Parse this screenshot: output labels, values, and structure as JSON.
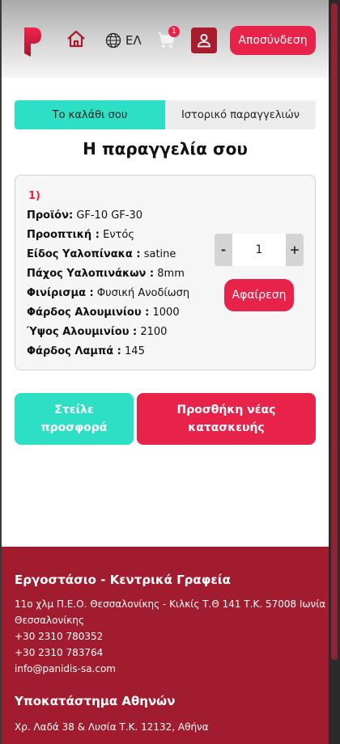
{
  "header": {
    "language": "ΕΛ",
    "cart_count": "1",
    "logout_label": "Αποσύνδεση",
    "brand_color": "#e8234a"
  },
  "tabs": [
    {
      "label": "Το καλάθι σου",
      "active": true
    },
    {
      "label": "Ιστορικό παραγγελιών",
      "active": false
    }
  ],
  "order": {
    "title": "Η παραγγελία σου",
    "item_number": "1)",
    "specs": [
      {
        "label": "Προϊόν:",
        "value": "GF-10 GF-30"
      },
      {
        "label": "Προοπτική :",
        "value": "Εντός"
      },
      {
        "label": "Είδος Υαλοπίνακα :",
        "value": "satine"
      },
      {
        "label": "Πάχος Υαλοπινάκων :",
        "value": "8mm"
      },
      {
        "label": "Φινίρισμα :",
        "value": "Φυσική Ανοδίωση"
      },
      {
        "label": "Φάρδος Αλουμινίου :",
        "value": "1000"
      },
      {
        "label": "Ύψος Αλουμινίου :",
        "value": "2100"
      },
      {
        "label": "Φάρδος Λαμπά :",
        "value": "145"
      }
    ],
    "quantity": "1",
    "minus_label": "-",
    "plus_label": "+",
    "remove_label": "Αφαίρεση"
  },
  "actions": {
    "send_offer": "Στείλε προσφορά",
    "add_new": "Προσθήκη νέας κατασκευής"
  },
  "footer": {
    "hq_title": "Εργοστάσιο - Κεντρικά Γραφεία",
    "hq_address_line1": "11ο χλμ Π.Ε.Ο. Θεσσαλονίκης - Κιλκίς Τ.Θ 141 Τ.Κ. 57008 Ιωνία",
    "hq_address_line2": "Θεσσαλονίκης",
    "phone1": "+30 2310 780352",
    "phone2": "+30 2310 783764",
    "email": "info@panidis-sa.com",
    "branch_title": "Υποκατάστημα Αθηνών",
    "branch_address": "Χρ. Λαδά 38 & Λυσία Τ.Κ. 12132, Αθήνα"
  }
}
